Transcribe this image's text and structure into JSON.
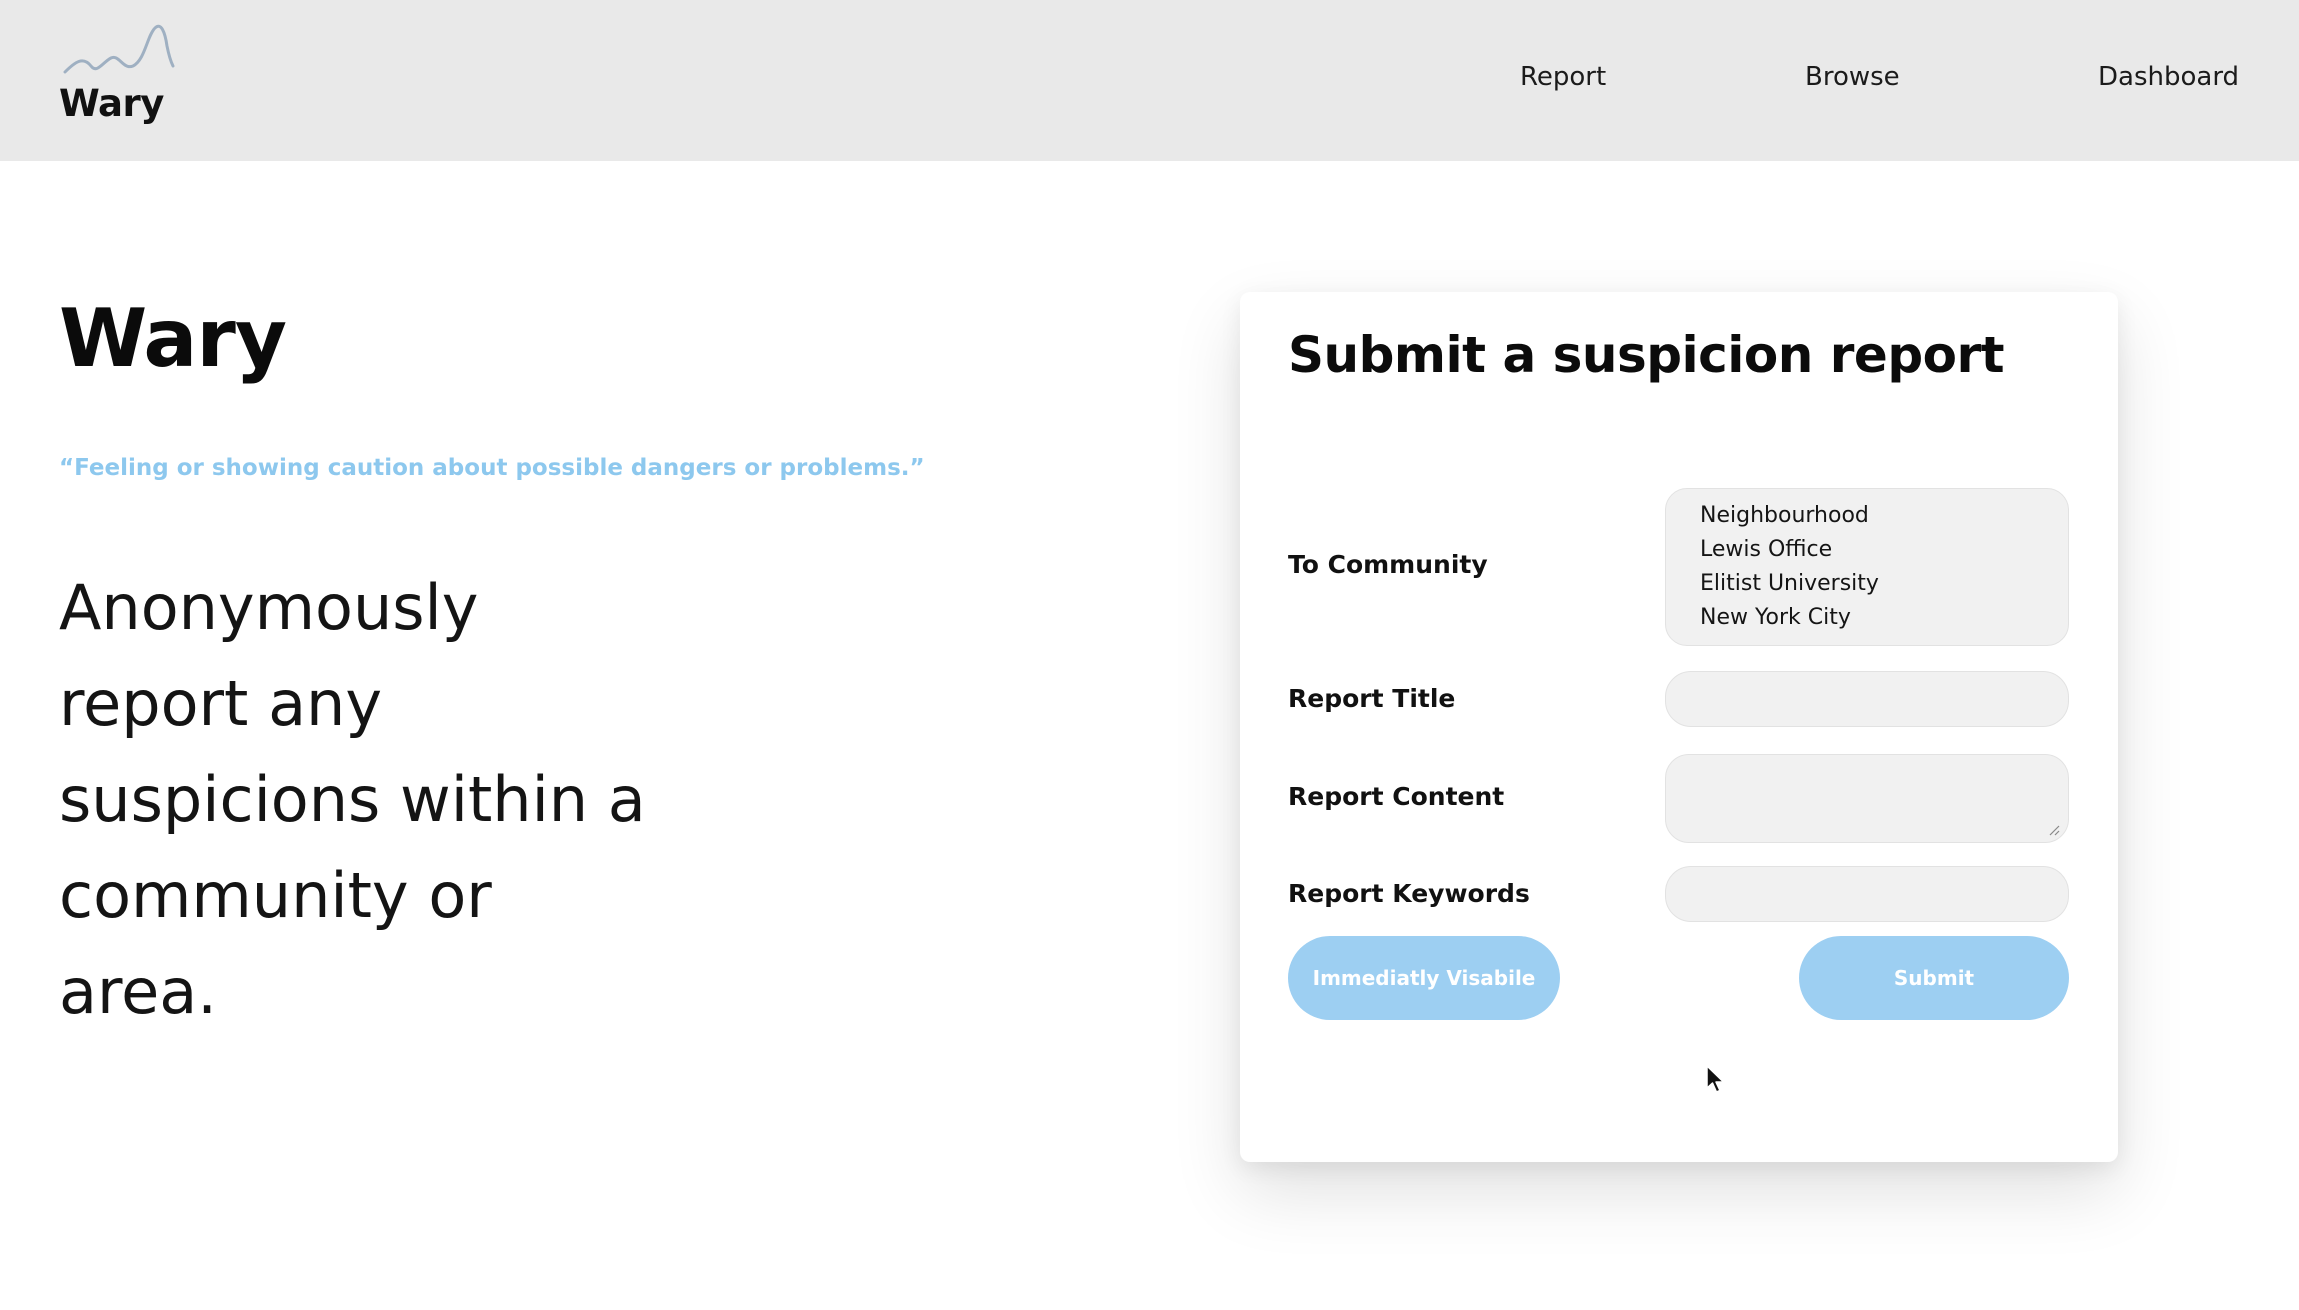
{
  "header": {
    "logo_text": "Wary",
    "nav": [
      {
        "label": "Report"
      },
      {
        "label": "Browse"
      },
      {
        "label": "Dashboard"
      }
    ]
  },
  "hero": {
    "title": "Wary",
    "quote": "“Feeling or showing caution about possible dangers or problems.”",
    "tagline": "Anonymously report any suspicions within a community or area."
  },
  "form": {
    "title": "Submit a suspicion report",
    "community_label": "To Community",
    "community_options": [
      "Neighbourhood",
      "Lewis Office",
      "Elitist University",
      "New York City"
    ],
    "report_title_label": "Report Title",
    "report_title_value": "",
    "report_content_label": "Report Content",
    "report_content_value": "",
    "report_keywords_label": "Report Keywords",
    "report_keywords_value": "",
    "visible_button_label": "Immediatly Visabile",
    "submit_button_label": "Submit"
  },
  "colors": {
    "nav_background": "#e9e9e9",
    "accent": "#9dcff2",
    "quote": "#8dc8ee"
  },
  "icons": {
    "logo": "wave-logo-icon",
    "cursor": "mouse-pointer-icon"
  }
}
